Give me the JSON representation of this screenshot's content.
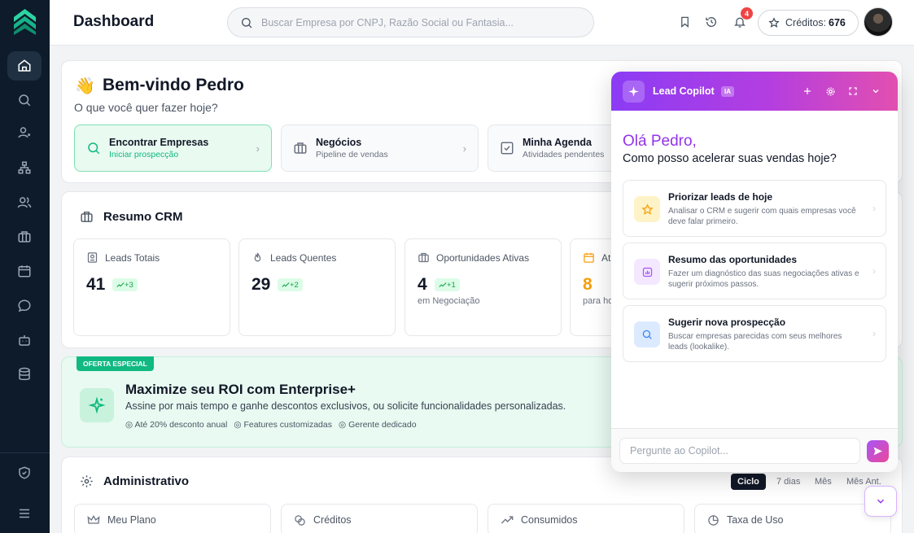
{
  "header": {
    "title": "Dashboard",
    "search_placeholder": "Buscar Empresa por CNPJ, Razão Social ou Fantasia...",
    "notification_count": "4",
    "credits_label": "Créditos:",
    "credits_value": "676"
  },
  "sidebar": {
    "items": [
      {
        "icon": "home-icon",
        "active": true
      },
      {
        "icon": "search-icon"
      },
      {
        "icon": "user-icon"
      },
      {
        "icon": "org-chart-icon"
      },
      {
        "icon": "users-icon"
      },
      {
        "icon": "briefcase-icon"
      },
      {
        "icon": "calendar-icon"
      },
      {
        "icon": "chat-icon"
      },
      {
        "icon": "bot-icon"
      },
      {
        "icon": "database-icon"
      },
      {
        "icon": "shield-icon"
      },
      {
        "icon": "menu-icon"
      }
    ]
  },
  "welcome": {
    "emoji": "👋",
    "title": "Bem-vindo Pedro",
    "subtitle": "O que você quer fazer hoje?",
    "actions": [
      {
        "title": "Encontrar Empresas",
        "subtitle": "Iniciar prospecção"
      },
      {
        "title": "Negócios",
        "subtitle": "Pipeline de vendas"
      },
      {
        "title": "Minha Agenda",
        "subtitle": "Atividades pendentes"
      }
    ]
  },
  "crm": {
    "title": "Resumo CRM",
    "stats": [
      {
        "label": "Leads Totais",
        "value": "41",
        "delta": "+3",
        "foot": ""
      },
      {
        "label": "Leads Quentes",
        "value": "29",
        "delta": "+2",
        "foot": ""
      },
      {
        "label": "Oportunidades Ativas",
        "value": "4",
        "delta": "+1",
        "foot": "em Negociação"
      },
      {
        "label": "At",
        "value": "8",
        "delta": "",
        "foot": "para ho"
      }
    ]
  },
  "promo": {
    "tag": "OFERTA ESPECIAL",
    "title": "Maximize seu ROI com Enterprise+",
    "description": "Assine por mais tempo e ganhe descontos exclusivos, ou solicite funcionalidades personalizadas.",
    "features": [
      "Até 20% desconto anual",
      "Features customizadas",
      "Gerente dedicado"
    ]
  },
  "admin": {
    "title": "Administrativo",
    "periods": [
      "Ciclo",
      "7 dias",
      "Mês",
      "Mês Ant."
    ],
    "cards": [
      "Meu Plano",
      "Créditos",
      "Consumidos",
      "Taxa de Uso"
    ]
  },
  "copilot": {
    "title": "Lead Copilot",
    "badge": "IA",
    "greeting": "Olá Pedro,",
    "question": "Como posso acelerar suas vendas hoje?",
    "suggestions": [
      {
        "title": "Priorizar leads de hoje",
        "description": "Analisar o CRM e sugerir com quais empresas você deve falar primeiro.",
        "icon": "star-icon",
        "color": "#f59e0b",
        "bg": "#fef3c7"
      },
      {
        "title": "Resumo das oportunidades",
        "description": "Fazer um diagnóstico das suas negociações ativas e sugerir próximos passos.",
        "icon": "bar-chart-icon",
        "color": "#a855f7",
        "bg": "#f3e8ff"
      },
      {
        "title": "Sugerir nova prospecção",
        "description": "Buscar empresas parecidas com seus melhores leads (lookalike).",
        "icon": "search-icon",
        "color": "#3b82f6",
        "bg": "#dbeafe"
      }
    ],
    "input_placeholder": "Pergunte ao Copilot..."
  }
}
